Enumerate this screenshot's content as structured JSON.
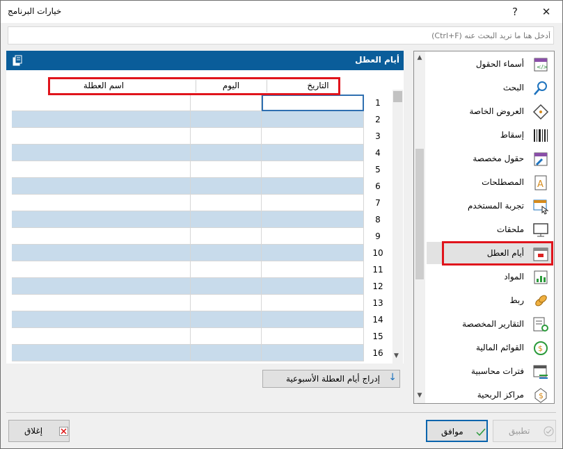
{
  "window": {
    "title": "خيارات البرنامج",
    "help": "?",
    "close": "✕"
  },
  "search": {
    "placeholder": "أدخل هنا ما تريد البحث عنه (Ctrl+F)"
  },
  "panel": {
    "title": "أيام العطل"
  },
  "grid": {
    "columns": [
      "التاريخ",
      "اليوم",
      "اسم العطلة"
    ],
    "rows": [
      "1",
      "2",
      "3",
      "4",
      "5",
      "6",
      "7",
      "8",
      "9",
      "10",
      "11",
      "12",
      "13",
      "14",
      "15",
      "16"
    ]
  },
  "insert_button": {
    "label": "إدراج أيام العطلة الأسبوعية"
  },
  "nav": {
    "selected": "أيام العطل",
    "items": [
      {
        "label": "أسماء الحقول",
        "icon": "field-names-icon"
      },
      {
        "label": "البحث",
        "icon": "search-icon"
      },
      {
        "label": "العروض  الخاصة",
        "icon": "tag-icon"
      },
      {
        "label": "إسقاط",
        "icon": "barcode-icon"
      },
      {
        "label": "حقول مخصصة",
        "icon": "custom-fields-icon"
      },
      {
        "label": "المصطلحات",
        "icon": "terms-icon"
      },
      {
        "label": "تجربة المستخدم",
        "icon": "user-experience-icon"
      },
      {
        "label": "ملحقات",
        "icon": "monitor-icon"
      },
      {
        "label": "أيام العطل",
        "icon": "calendar-icon"
      },
      {
        "label": "المواد",
        "icon": "box-chart-icon"
      },
      {
        "label": "ربط",
        "icon": "link-icon"
      },
      {
        "label": "التقارير المخصصة",
        "icon": "report-gear-icon"
      },
      {
        "label": "القوائم المالية",
        "icon": "money-cycle-icon"
      },
      {
        "label": "فترات محاسبية",
        "icon": "calendar-arrows-icon"
      },
      {
        "label": "مراكز الربحية",
        "icon": "profit-center-icon"
      }
    ]
  },
  "buttons": {
    "close": "إغلاق",
    "ok": "موافق",
    "apply": "تطبيق"
  },
  "colors": {
    "header": "#0a5d9a",
    "highlight": "#e0141c",
    "alt_row": "#c8dbeb"
  }
}
